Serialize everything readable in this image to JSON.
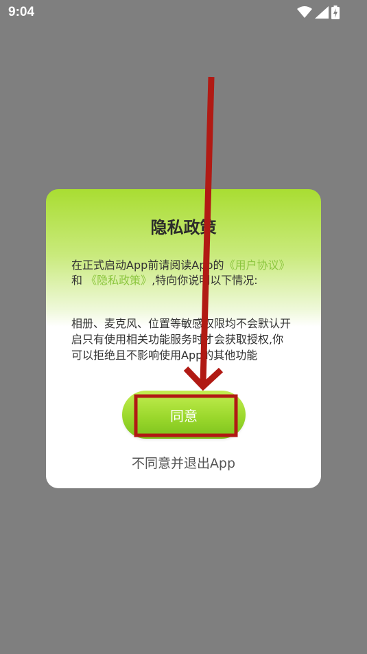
{
  "status_bar": {
    "time": "9:04",
    "icons": [
      "wifi-icon",
      "cell-signal-icon",
      "battery-charging-icon"
    ]
  },
  "dialog": {
    "title": "隐私政策",
    "intro_text": "在正式启动App前请阅读App的",
    "user_agreement_link": "《用户协议》",
    "conjunction": " 和 ",
    "privacy_policy_link": "《隐私政策》",
    "intro_suffix": ",特向你说明以下情况:",
    "permissions_text": "相册、麦克风、位置等敏感权限均不会默认开启只有使用相关功能服务时才会获取授权,你可以拒绝且不影响使用App的其他功能",
    "agree_button": "同意",
    "disagree_link": "不同意并退出App"
  },
  "colors": {
    "overlay": "#7f7f7f",
    "accent_green": "#9bd82c",
    "link_green": "#8cc63f",
    "annotation_red": "#b11a14"
  }
}
